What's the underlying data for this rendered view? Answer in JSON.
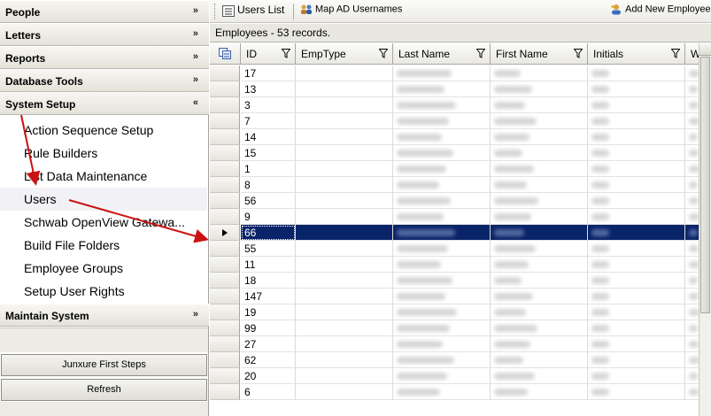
{
  "nav": {
    "sections": [
      {
        "label": "People",
        "chevron": "»"
      },
      {
        "label": "Letters",
        "chevron": "»"
      },
      {
        "label": "Reports",
        "chevron": "»"
      },
      {
        "label": "Database Tools",
        "chevron": "»"
      },
      {
        "label": "System Setup",
        "chevron": "«"
      }
    ],
    "items": [
      "Action Sequence Setup",
      "Rule Builders",
      "List Data Maintenance",
      "Users",
      "Schwab  OpenView  Gatewa...",
      "Build File Folders",
      "Employee Groups",
      "Setup User Rights"
    ],
    "maintain": {
      "label": "Maintain System",
      "chevron": "»"
    },
    "buttons": {
      "first_steps": "Junxure First Steps",
      "refresh": "Refresh"
    }
  },
  "toolbar": {
    "users_list": "Users List",
    "map_ad": "Map AD Usernames",
    "add_employee": "Add New Employee"
  },
  "caption": "Employees - 53 records.",
  "grid": {
    "columns": [
      "ID",
      "EmpType",
      "Last Name",
      "First Name",
      "Initials",
      "Wi"
    ],
    "selected_id": "66",
    "ids": [
      "17",
      "13",
      "3",
      "7",
      "14",
      "15",
      "1",
      "8",
      "56",
      "9",
      "66",
      "55",
      "11",
      "18",
      "147",
      "19",
      "99",
      "27",
      "62",
      "20",
      "6"
    ]
  },
  "colors": {
    "selection": "#0a246a",
    "arrow": "#cc1111"
  },
  "icons": {
    "row_indicator": "triangle-right-icon",
    "filter": "funnel-icon",
    "chooser": "column-chooser-icon"
  }
}
